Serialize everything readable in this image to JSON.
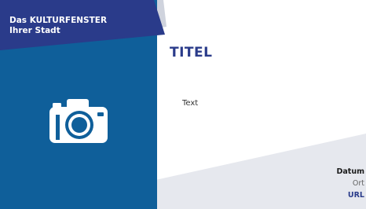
{
  "brand": {
    "line1": "Das KULTURFENSTER",
    "line2": "Ihrer Stadt"
  },
  "content": {
    "title": "TITEL",
    "text": "Text"
  },
  "footer": {
    "date": "Datum",
    "place": "Ort",
    "url": "URL"
  },
  "colors": {
    "primary_blue": "#0f5f9a",
    "accent_navy": "#2a3b8a",
    "light_gray": "#e6e8ee",
    "mid_gray": "#cfd3dd"
  },
  "icons": {
    "image_placeholder": "camera-icon"
  }
}
